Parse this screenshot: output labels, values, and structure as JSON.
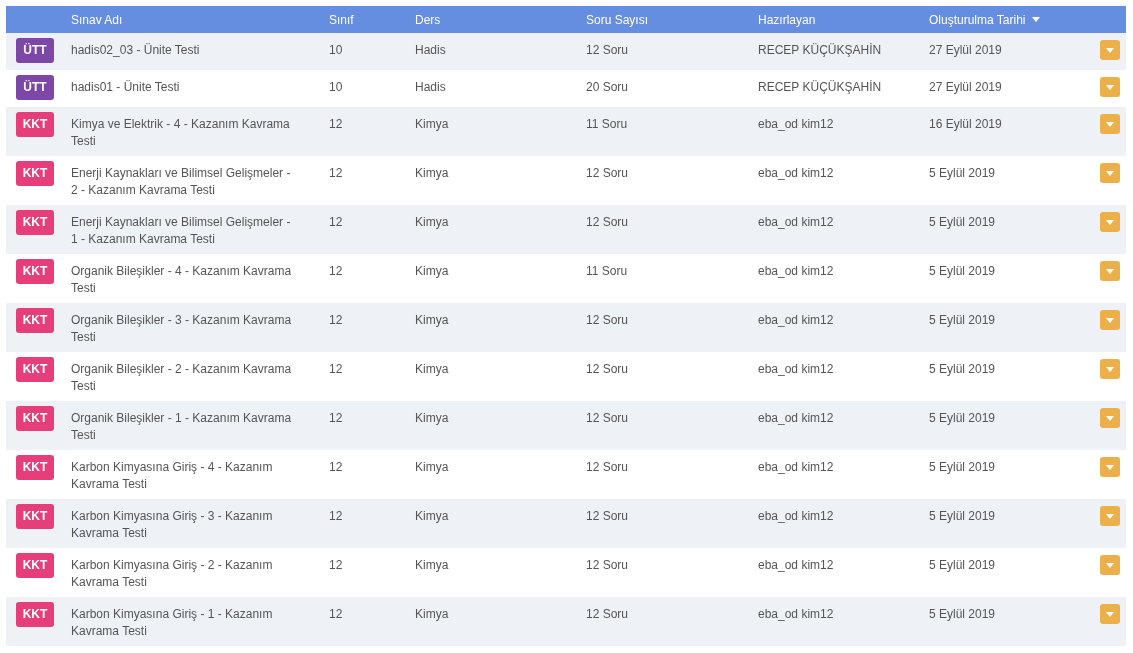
{
  "table": {
    "columns": [
      {
        "label": "Sınav Adı",
        "sorted": false
      },
      {
        "label": "Sınıf",
        "sorted": false
      },
      {
        "label": "Ders",
        "sorted": false
      },
      {
        "label": "Soru Sayısı",
        "sorted": false
      },
      {
        "label": "Hazırlayan",
        "sorted": false
      },
      {
        "label": "Oluşturulma Tarihi",
        "sorted": true
      }
    ],
    "rows": [
      {
        "badge": "ÜTT",
        "color": "#7d47a8",
        "name": "hadis02_03 - Ünite Testi",
        "grade": "10",
        "subject": "Hadis",
        "questions": "12 Soru",
        "author": "RECEP KÜÇÜKŞAHİN",
        "date": "27 Eylül 2019"
      },
      {
        "badge": "ÜTT",
        "color": "#7d47a8",
        "name": "hadis01 - Ünite Testi",
        "grade": "10",
        "subject": "Hadis",
        "questions": "20 Soru",
        "author": "RECEP KÜÇÜKŞAHİN",
        "date": "27 Eylül 2019"
      },
      {
        "badge": "KKT",
        "color": "#e63d7b",
        "name": "Kimya ve Elektrik - 4 - Kazanım Kavrama Testi",
        "grade": "12",
        "subject": "Kimya",
        "questions": "11 Soru",
        "author": "eba_od kim12",
        "date": "16 Eylül 2019"
      },
      {
        "badge": "KKT",
        "color": "#e63d7b",
        "name": "Enerji Kaynakları ve Bilimsel Gelişmeler - 2 - Kazanım Kavrama Testi",
        "grade": "12",
        "subject": "Kimya",
        "questions": "12 Soru",
        "author": "eba_od kim12",
        "date": "5 Eylül 2019"
      },
      {
        "badge": "KKT",
        "color": "#e63d7b",
        "name": "Enerji Kaynakları ve Bilimsel Gelişmeler - 1 - Kazanım Kavrama Testi",
        "grade": "12",
        "subject": "Kimya",
        "questions": "12 Soru",
        "author": "eba_od kim12",
        "date": "5 Eylül 2019"
      },
      {
        "badge": "KKT",
        "color": "#e63d7b",
        "name": "Organik Bileşikler - 4 - Kazanım Kavrama Testi",
        "grade": "12",
        "subject": "Kimya",
        "questions": "11 Soru",
        "author": "eba_od kim12",
        "date": "5 Eylül 2019"
      },
      {
        "badge": "KKT",
        "color": "#e63d7b",
        "name": "Organik Bileşikler - 3 - Kazanım Kavrama Testi",
        "grade": "12",
        "subject": "Kimya",
        "questions": "12 Soru",
        "author": "eba_od kim12",
        "date": "5 Eylül 2019"
      },
      {
        "badge": "KKT",
        "color": "#e63d7b",
        "name": "Organik Bileşikler - 2 - Kazanım Kavrama Testi",
        "grade": "12",
        "subject": "Kimya",
        "questions": "12 Soru",
        "author": "eba_od kim12",
        "date": "5 Eylül 2019"
      },
      {
        "badge": "KKT",
        "color": "#e63d7b",
        "name": "Organik Bileşikler - 1 - Kazanım Kavrama Testi",
        "grade": "12",
        "subject": "Kimya",
        "questions": "12 Soru",
        "author": "eba_od kim12",
        "date": "5 Eylül 2019"
      },
      {
        "badge": "KKT",
        "color": "#e63d7b",
        "name": "Karbon Kimyasına Giriş - 4 - Kazanım Kavrama Testi",
        "grade": "12",
        "subject": "Kimya",
        "questions": "12 Soru",
        "author": "eba_od kim12",
        "date": "5 Eylül 2019"
      },
      {
        "badge": "KKT",
        "color": "#e63d7b",
        "name": "Karbon Kimyasına Giriş - 3 - Kazanım Kavrama Testi",
        "grade": "12",
        "subject": "Kimya",
        "questions": "12 Soru",
        "author": "eba_od kim12",
        "date": "5 Eylül 2019"
      },
      {
        "badge": "KKT",
        "color": "#e63d7b",
        "name": "Karbon Kimyasına Giriş - 2 - Kazanım Kavrama Testi",
        "grade": "12",
        "subject": "Kimya",
        "questions": "12 Soru",
        "author": "eba_od kim12",
        "date": "5 Eylül 2019"
      },
      {
        "badge": "KKT",
        "color": "#e63d7b",
        "name": "Karbon Kimyasına Giriş - 1 - Kazanım Kavrama Testi",
        "grade": "12",
        "subject": "Kimya",
        "questions": "12 Soru",
        "author": "eba_od kim12",
        "date": "5 Eylül 2019"
      }
    ]
  }
}
